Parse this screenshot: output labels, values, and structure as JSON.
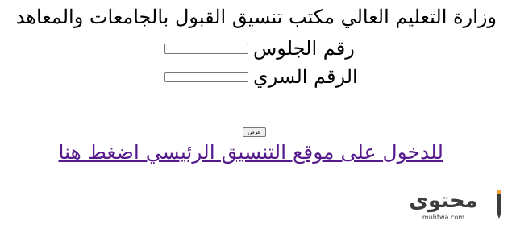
{
  "page": {
    "title": "وزارة التعليم العالي مكتب تنسيق القبول بالجامعات والمعاهد"
  },
  "form": {
    "seat_number_label": "رقم الجلوس",
    "seat_number_value": "",
    "secret_number_label": "الرقم السري",
    "secret_number_value": "",
    "submit_label": "عرض"
  },
  "link": {
    "main_site_text": "للدخول على موقع التنسيق الرئيسي اضغط هنا",
    "color": "#551a8b"
  },
  "watermark": {
    "logo_text": "محتوى",
    "logo_subtext": "muhtwa.com",
    "logo_color": "#3d3d3d",
    "accent_color": "#f0a030"
  }
}
